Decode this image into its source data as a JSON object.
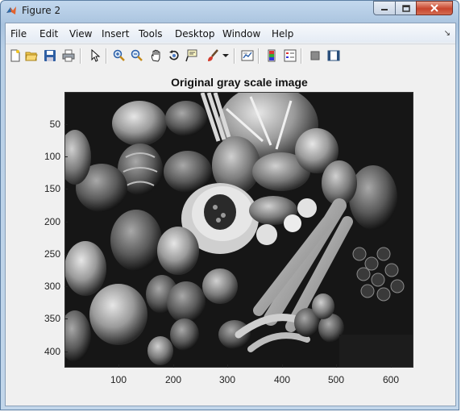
{
  "window": {
    "title": "Figure 2"
  },
  "menubar": {
    "items": [
      "File",
      "Edit",
      "View",
      "Insert",
      "Tools",
      "Desktop",
      "Window",
      "Help"
    ]
  },
  "toolbar": {
    "icons": [
      "new-figure-icon",
      "open-file-icon",
      "save-icon",
      "print-icon",
      "pointer-icon",
      "zoom-in-icon",
      "zoom-out-icon",
      "pan-icon",
      "rotate-3d-icon",
      "data-cursor-icon",
      "brush-icon",
      "dropdown-arrow-icon",
      "link-plot-icon",
      "insert-colorbar-icon",
      "insert-legend-icon",
      "hide-plot-tools-icon",
      "show-plot-tools-icon"
    ]
  },
  "plot": {
    "title": "Original gray scale image",
    "y_ticks": [
      "50",
      "100",
      "150",
      "200",
      "250",
      "300",
      "350",
      "400"
    ],
    "x_ticks": [
      "100",
      "200",
      "300",
      "400",
      "500",
      "600"
    ],
    "image_description_icon": "grayscale-fruits-vegetables-image"
  },
  "colors": {
    "close_button": "#c8452d",
    "client_bg": "#f0f0f0",
    "frame": "#a9c3de"
  }
}
